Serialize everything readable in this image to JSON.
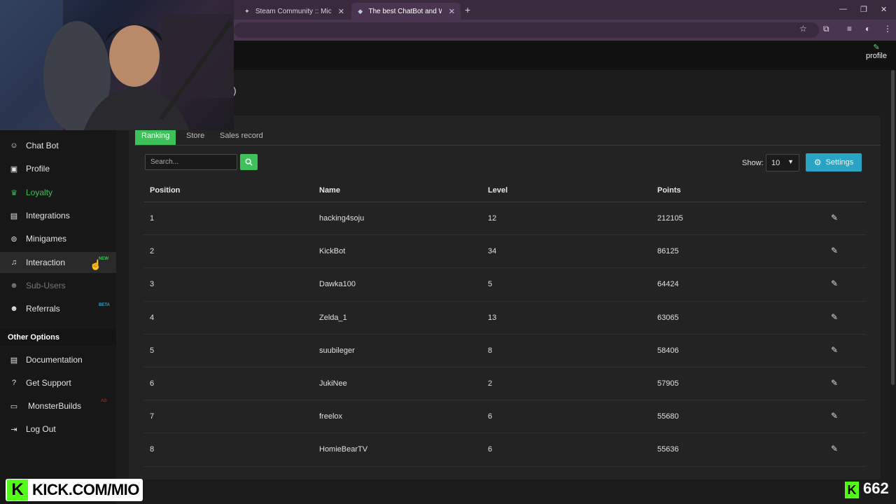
{
  "browser": {
    "tabs": [
      {
        "title": "Steam Community :: Mio :: Item",
        "active": false
      },
      {
        "title": "The best ChatBot and Widgets",
        "active": true
      }
    ]
  },
  "site": {
    "profile_link": "profile",
    "breadcrumb_fragment": ")",
    "sidebar": {
      "items": [
        {
          "label": "Chat Bot",
          "icon": "robot-icon"
        },
        {
          "label": "Profile",
          "icon": "id-card-icon"
        },
        {
          "label": "Loyalty",
          "icon": "trophy-icon",
          "active": true
        },
        {
          "label": "Integrations",
          "icon": "plug-icon"
        },
        {
          "label": "Minigames",
          "icon": "gamepad-icon"
        },
        {
          "label": "Interaction",
          "icon": "music-icon",
          "badge": "NEW"
        },
        {
          "label": "Sub-Users",
          "icon": "users-icon",
          "disabled": true
        },
        {
          "label": "Referrals",
          "icon": "user-group-icon",
          "badge": "BETA"
        }
      ],
      "section_title": "Other Options",
      "other_items": [
        {
          "label": "Documentation",
          "icon": "book-icon"
        },
        {
          "label": "Get Support",
          "icon": "question-icon"
        },
        {
          "label": "MonsterBuilds",
          "icon": "laptop-icon",
          "badge": "AD"
        },
        {
          "label": "Log Out",
          "icon": "logout-icon"
        }
      ]
    },
    "tabs": [
      {
        "label": "Ranking",
        "active": true
      },
      {
        "label": "Store"
      },
      {
        "label": "Sales record"
      }
    ],
    "search": {
      "placeholder": "Search..."
    },
    "show_label": "Show:",
    "show_value": "10",
    "settings_label": "Settings",
    "table": {
      "headers": [
        "Position",
        "Name",
        "Level",
        "Points"
      ],
      "rows": [
        {
          "position": "1",
          "name": "hacking4soju",
          "level": "12",
          "points": "212105"
        },
        {
          "position": "2",
          "name": "KickBot",
          "level": "34",
          "points": "86125"
        },
        {
          "position": "3",
          "name": "Dawka100",
          "level": "5",
          "points": "64424"
        },
        {
          "position": "4",
          "name": "Zelda_1",
          "level": "13",
          "points": "63065"
        },
        {
          "position": "5",
          "name": "suubileger",
          "level": "8",
          "points": "58406"
        },
        {
          "position": "6",
          "name": "JukiNee",
          "level": "2",
          "points": "57905"
        },
        {
          "position": "7",
          "name": "freelox",
          "level": "6",
          "points": "55680"
        },
        {
          "position": "8",
          "name": "HomieBearTV",
          "level": "6",
          "points": "55636"
        }
      ]
    }
  },
  "overlay": {
    "kick_logo": "K",
    "kick_url": "KICK.COM/MIO",
    "viewer_count": "662"
  },
  "colors": {
    "accent_green": "#3ec15a",
    "settings_blue": "#2aa4c4",
    "kick_green": "#53fc18",
    "browser_purple": "#3a2a3e"
  }
}
